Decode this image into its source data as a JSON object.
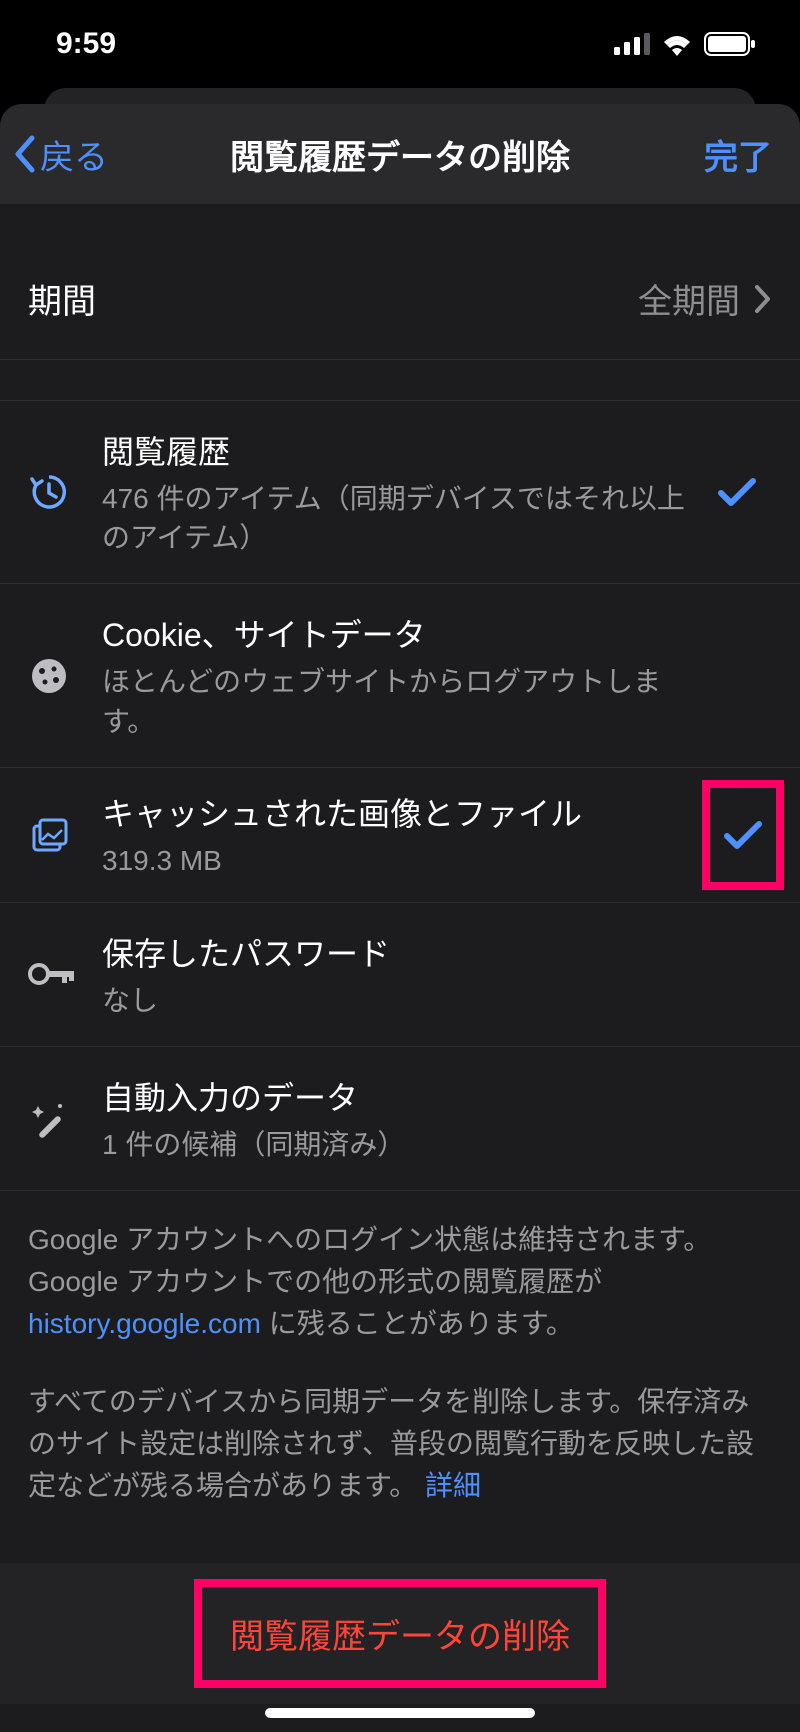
{
  "status": {
    "time": "9:59"
  },
  "nav": {
    "back": "戻る",
    "title": "閲覧履歴データの削除",
    "done": "完了"
  },
  "period": {
    "label": "期間",
    "value": "全期間"
  },
  "items": {
    "history": {
      "title": "閲覧履歴",
      "sub": "476 件のアイテム（同期デバイスではそれ以上のアイテム）"
    },
    "cookies": {
      "title": "Cookie、サイトデータ",
      "sub": "ほとんどのウェブサイトからログアウトします。"
    },
    "cache": {
      "title": "キャッシュされた画像とファイル",
      "sub": "319.3 MB"
    },
    "passwords": {
      "title": "保存したパスワード",
      "sub": "なし"
    },
    "autofill": {
      "title": "自動入力のデータ",
      "sub": "1 件の候補（同期済み）"
    }
  },
  "footer": {
    "line1a": "Google アカウントへのログイン状態は維持されます。Google アカウントでの他の形式の閲覧履歴が ",
    "link1": "history.google.com",
    "line1b": " に残ることがあります。",
    "line2a": "すべてのデバイスから同期データを削除します。保存済みのサイト設定は削除されず、普段の閲覧行動を反映した設定などが残る場合があります。",
    "link2": "詳細"
  },
  "action": {
    "label": "閲覧履歴データの削除"
  }
}
